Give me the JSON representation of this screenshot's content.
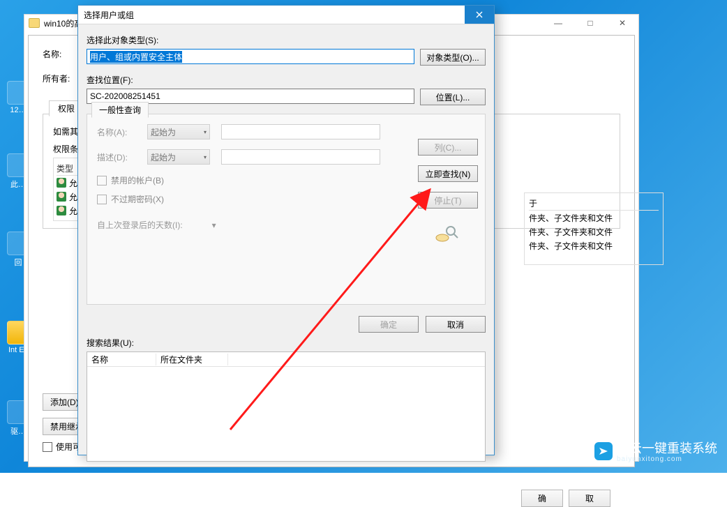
{
  "desktop": {
    "icons": [
      {
        "label": "12…",
        "name": "desktop-icon-1"
      },
      {
        "label": "此…",
        "name": "desktop-icon-2"
      },
      {
        "label": "回",
        "name": "desktop-icon-3"
      },
      {
        "label": "Int Ex",
        "name": "desktop-icon-ie"
      },
      {
        "label": "驱…",
        "name": "desktop-icon-5"
      }
    ]
  },
  "base_window": {
    "title": "win10的高",
    "controls": {
      "min": "—",
      "max": "□",
      "close": "✕"
    }
  },
  "sec_window": {
    "name_label": "名称:",
    "owner_label": "所有者:",
    "tab": "权限",
    "other_text": "如需其他信",
    "perm_list_label": "权限条目:",
    "header_col": "类型",
    "rows": [
      "允许",
      "允许",
      "允许"
    ],
    "apply_col_label": "于",
    "apply_values": [
      "件夹、子文件夹和文件",
      "件夹、子文件夹和文件",
      "件夹、子文件夹和文件"
    ],
    "add_btn": "添加(D)",
    "disable_btn": "禁用继承",
    "checkbox_text": "使用可从",
    "ok": "确",
    "cancel": "取"
  },
  "dialog": {
    "title": "选择用户或组",
    "object_type_label": "选择此对象类型(S):",
    "object_type_value": "用户、组或内置安全主体",
    "object_type_btn": "对象类型(O)...",
    "location_label": "查找位置(F):",
    "location_value": "SC-202008251451",
    "location_btn": "位置(L)...",
    "tab": "一般性查询",
    "q_name_label": "名称(A):",
    "q_name_op": "起始为",
    "q_desc_label": "描述(D):",
    "q_desc_op": "起始为",
    "chk_disabled": "禁用的帐户(B)",
    "chk_noexpire": "不过期密码(X)",
    "days_label": "自上次登录后的天数(I):",
    "btn_columns": "列(C)...",
    "btn_findnow": "立即查找(N)",
    "btn_stop": "停止(T)",
    "btn_ok": "确定",
    "btn_cancel": "取消",
    "results_label": "搜索结果(U):",
    "results_cols": {
      "name": "名称",
      "folder": "所在文件夹"
    }
  },
  "watermark": {
    "text": "白云一键重装系统",
    "url": "baiyunxitong.com"
  }
}
